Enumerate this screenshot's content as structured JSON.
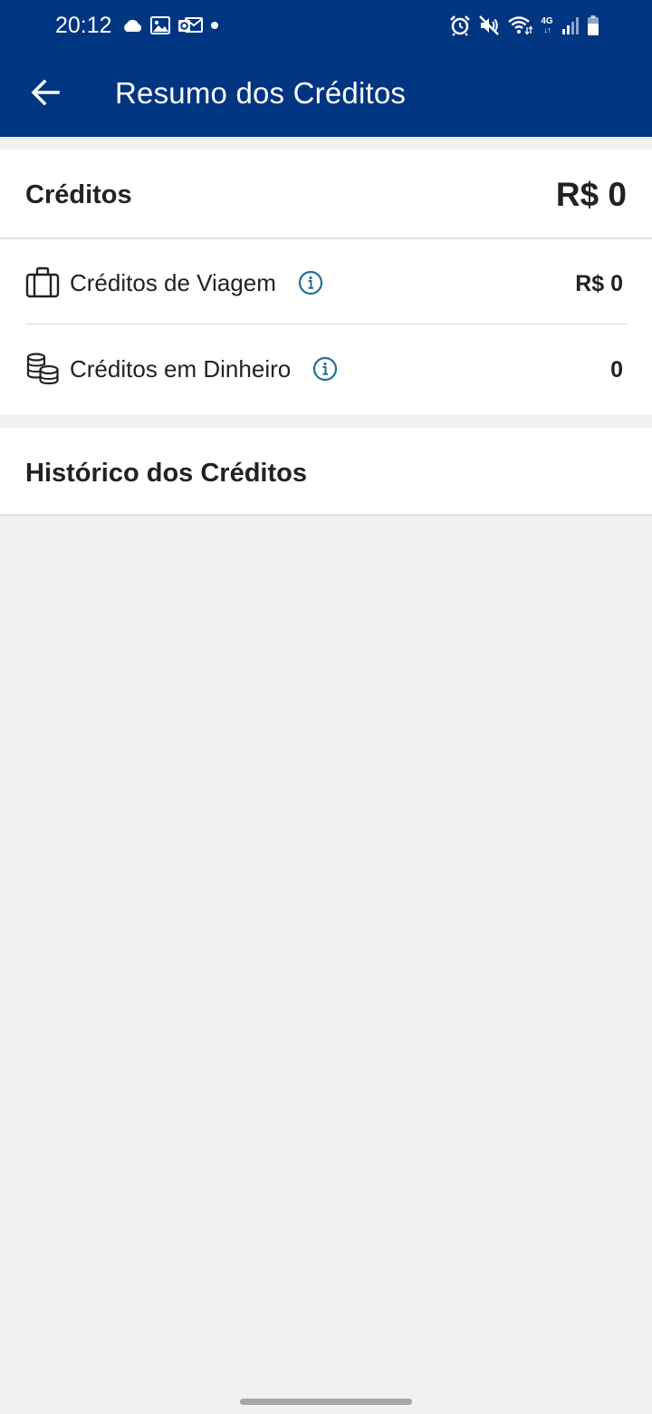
{
  "status_bar": {
    "time": "20:12",
    "left_icons": [
      "cloud-icon",
      "image-icon",
      "outlook-icon",
      "dot-icon"
    ],
    "right_icons": [
      "alarm-icon",
      "mute-icon",
      "wifi-icon",
      "network-4g-icon",
      "signal-icon",
      "battery-icon"
    ],
    "network_label": "4G",
    "network_arrows": "↓↑"
  },
  "header": {
    "title": "Resumo dos Créditos",
    "back_icon": "arrow-left-icon",
    "background_color": "#003582"
  },
  "summary": {
    "title": "Créditos",
    "total": "R$ 0",
    "rows": [
      {
        "label": "Créditos de Viagem",
        "value": "R$ 0",
        "icon": "suitcase-icon",
        "info_icon": "info-icon"
      },
      {
        "label": "Créditos em Dinheiro",
        "value": "0",
        "icon": "coins-icon",
        "info_icon": "info-icon"
      }
    ]
  },
  "history": {
    "title": "Histórico dos Créditos"
  },
  "colors": {
    "accent": "#003582",
    "info": "#1f6f9a",
    "page_background": "#f1f1f1"
  }
}
